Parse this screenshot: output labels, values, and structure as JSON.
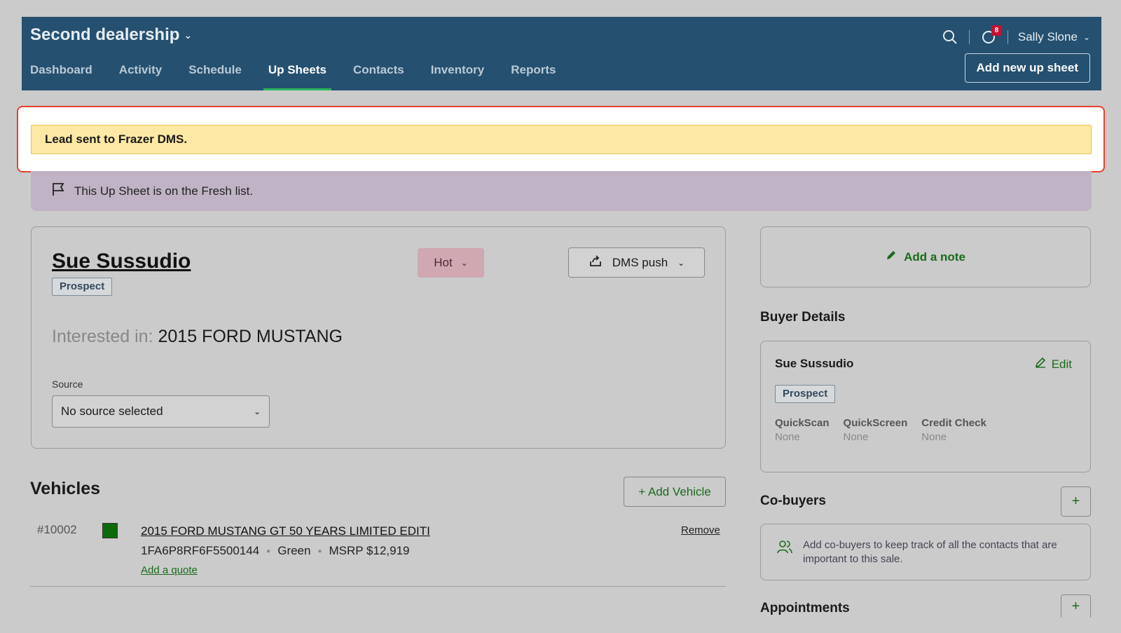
{
  "header": {
    "dealership": "Second dealership",
    "nav": [
      "Dashboard",
      "Activity",
      "Schedule",
      "Up Sheets",
      "Contacts",
      "Inventory",
      "Reports"
    ],
    "active_nav": "Up Sheets",
    "notification_count": "8",
    "user_name": "Sally Slone",
    "add_button": "Add new up sheet"
  },
  "alert": {
    "message": "Lead sent to Frazer DMS."
  },
  "fresh_banner": {
    "text": "This Up Sheet is on the Fresh list."
  },
  "lead": {
    "name": "Sue Sussudio",
    "tag": "Prospect",
    "temperature": "Hot",
    "dms_button": "DMS push",
    "interested_label": "Interested in:",
    "interested_vehicle": "2015 FORD MUSTANG",
    "source_label": "Source",
    "source_value": "No source selected"
  },
  "vehicles": {
    "title": "Vehicles",
    "add_button": "+ Add Vehicle",
    "items": [
      {
        "number": "#10002",
        "color_hex": "#0b6b0b",
        "name": "2015 FORD MUSTANG GT 50 YEARS LIMITED EDITI",
        "vin": "1FA6P8RF6F5500144",
        "color": "Green",
        "msrp": "MSRP $12,919",
        "remove": "Remove",
        "add_quote": "Add a quote"
      }
    ]
  },
  "sidebar": {
    "add_note": "Add a note",
    "buyer_title": "Buyer Details",
    "buyer_name": "Sue Sussudio",
    "edit_label": "Edit",
    "buyer_tag": "Prospect",
    "checks": [
      {
        "title": "QuickScan",
        "value": "None"
      },
      {
        "title": "QuickScreen",
        "value": "None"
      },
      {
        "title": "Credit Check",
        "value": "None"
      }
    ],
    "cobuyers_title": "Co-buyers",
    "cobuyers_text": "Add co-buyers to keep track of all the contacts that are important to this sale.",
    "appointments_title": "Appointments",
    "plus": "+"
  },
  "colors": {
    "header_bg": "#255070",
    "accent_green": "#1b6b1b",
    "alert_bg": "#fde9a5",
    "highlight_border": "#e8412c",
    "fresh_bg": "#c0b3c5"
  }
}
